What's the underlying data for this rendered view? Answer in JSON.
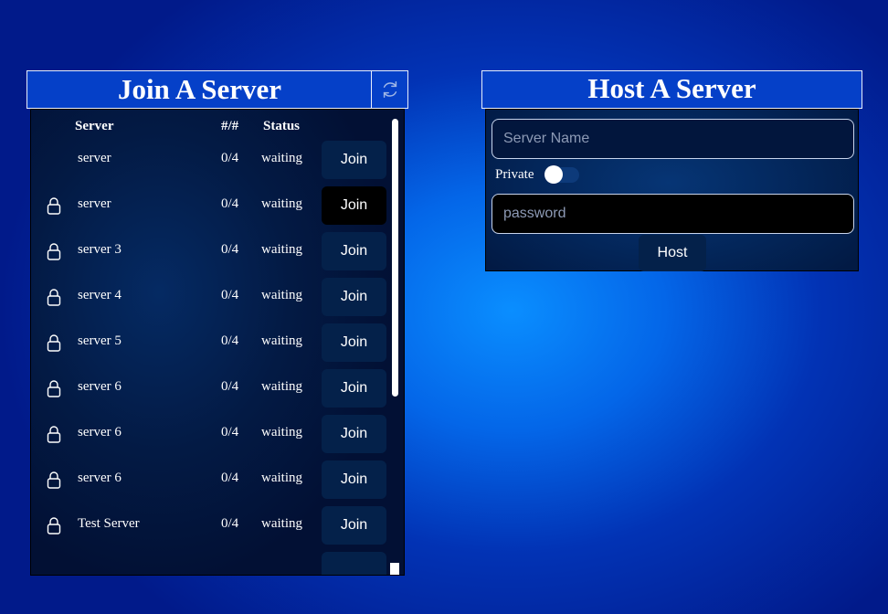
{
  "join": {
    "title": "Join A Server",
    "refresh_icon": "refresh-icon",
    "headers": {
      "server": "Server",
      "players": "#/#",
      "status": "Status"
    },
    "rows": [
      {
        "name": "server",
        "players": "0/4",
        "status": "waiting",
        "locked": false,
        "join_label": "Join"
      },
      {
        "name": "server",
        "players": "0/4",
        "status": "waiting",
        "locked": true,
        "join_label": "Join"
      },
      {
        "name": "server 3",
        "players": "0/4",
        "status": "waiting",
        "locked": true,
        "join_label": "Join"
      },
      {
        "name": "server 4",
        "players": "0/4",
        "status": "waiting",
        "locked": true,
        "join_label": "Join"
      },
      {
        "name": "server 5",
        "players": "0/4",
        "status": "waiting",
        "locked": true,
        "join_label": "Join"
      },
      {
        "name": "server 6",
        "players": "0/4",
        "status": "waiting",
        "locked": true,
        "join_label": "Join"
      },
      {
        "name": "server 6",
        "players": "0/4",
        "status": "waiting",
        "locked": true,
        "join_label": "Join"
      },
      {
        "name": "server 6",
        "players": "0/4",
        "status": "waiting",
        "locked": true,
        "join_label": "Join"
      },
      {
        "name": "Test Server",
        "players": "0/4",
        "status": "waiting",
        "locked": true,
        "join_label": "Join"
      }
    ]
  },
  "host": {
    "title": "Host A Server",
    "server_name_placeholder": "Server Name",
    "private_label": "Private",
    "private_enabled": false,
    "password_placeholder": "password",
    "host_label": "Host"
  },
  "colors": {
    "panel_title_bg": "#0540c8",
    "button_bg": "#04214a",
    "button_active_bg": "#000000"
  }
}
